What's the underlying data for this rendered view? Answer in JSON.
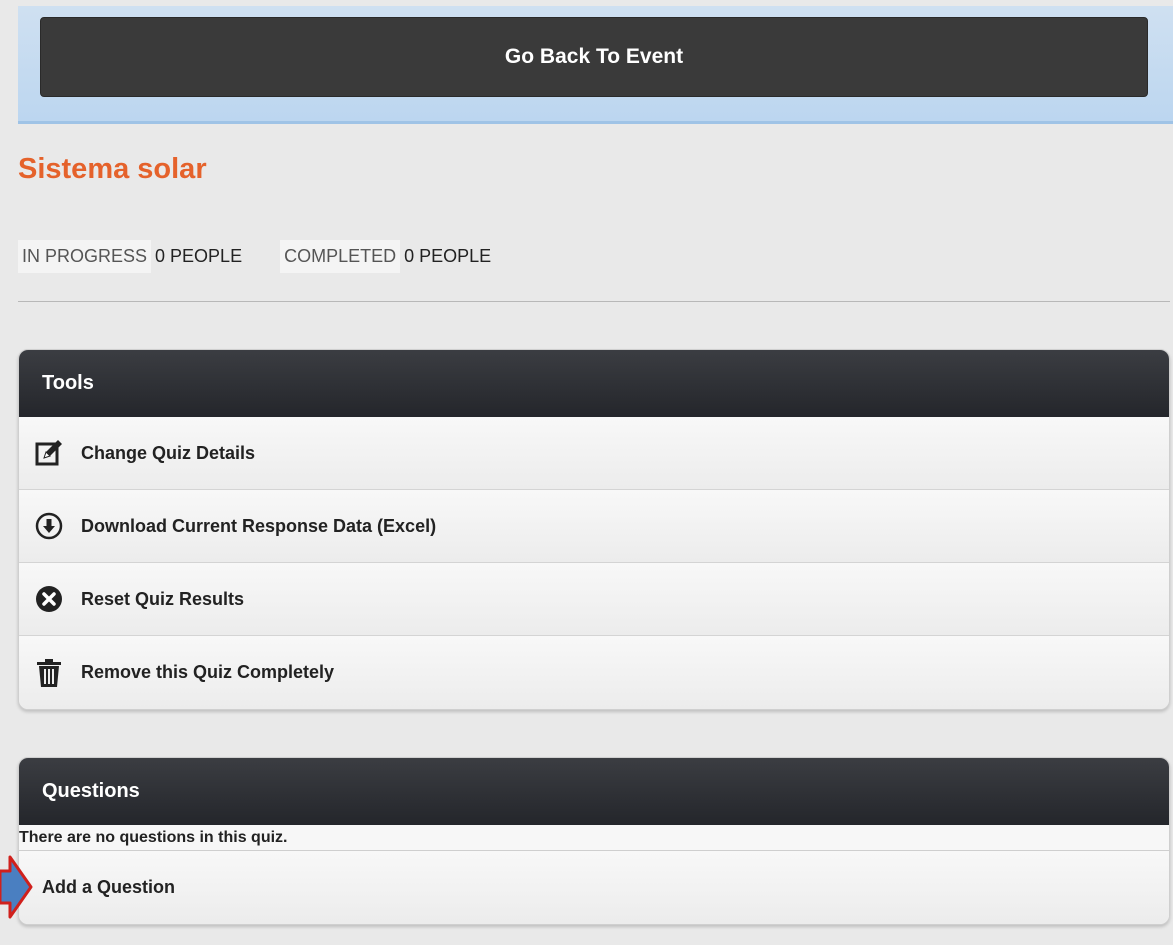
{
  "header": {
    "back_button": "Go Back To Event"
  },
  "quiz": {
    "title": "Sistema solar",
    "stats": [
      {
        "label": "IN PROGRESS",
        "value": "0 PEOPLE"
      },
      {
        "label": "COMPLETED",
        "value": "0 PEOPLE"
      }
    ]
  },
  "tools": {
    "heading": "Tools",
    "items": [
      {
        "label": "Change Quiz Details",
        "icon": "edit-icon"
      },
      {
        "label": "Download Current Response Data (Excel)",
        "icon": "download-circle-icon"
      },
      {
        "label": "Reset Quiz Results",
        "icon": "close-circle-icon"
      },
      {
        "label": "Remove this Quiz Completely",
        "icon": "trash-icon"
      }
    ]
  },
  "questions": {
    "heading": "Questions",
    "empty_message": "There are no questions in this quiz.",
    "add_label": "Add a Question"
  },
  "colors": {
    "accent": "#e5622b",
    "header_dark": "#2a2c31",
    "topbar": "#c6dcf1",
    "marker": "#4a7fc1",
    "marker_border": "#d0201c"
  }
}
